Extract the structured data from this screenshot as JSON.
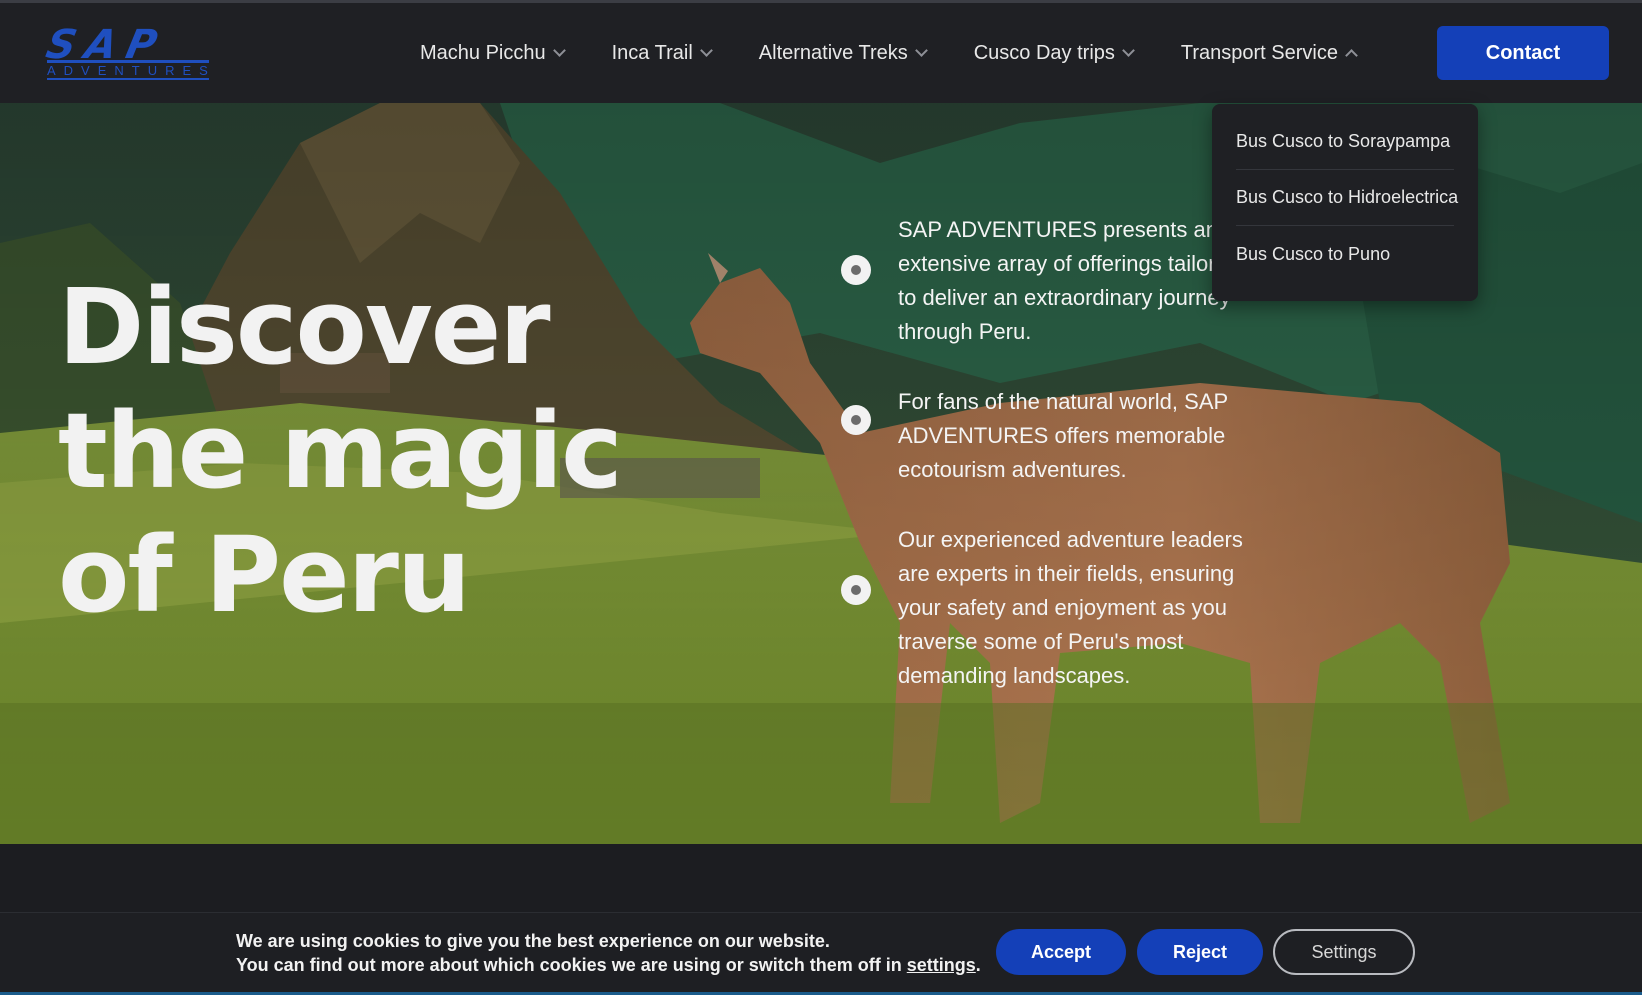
{
  "logo": {
    "main": "SAP",
    "sub": "ADVENTURES"
  },
  "nav": {
    "items": [
      {
        "label": "Machu Picchu"
      },
      {
        "label": "Inca Trail"
      },
      {
        "label": "Alternative Treks"
      },
      {
        "label": "Cusco Day trips"
      },
      {
        "label": "Transport Service"
      }
    ],
    "contact_label": "Contact"
  },
  "dropdown": {
    "items": [
      {
        "label": "Bus Cusco to Soraypampa"
      },
      {
        "label": "Bus Cusco to Hidroelectrica"
      },
      {
        "label": "Bus Cusco to Puno"
      }
    ]
  },
  "hero": {
    "headline_lines": [
      "Discover",
      "the magic",
      "of Peru"
    ],
    "bullets": [
      {
        "text": "SAP ADVENTURES presents an extensive array of offerings tailored to deliver an extraordinary journey through Peru."
      },
      {
        "text": "For fans of the natural world, SAP ADVENTURES offers memorable ecotourism adventures."
      },
      {
        "text": "Our experienced adventure leaders are experts in their fields, ensuring your safety and enjoyment as you traverse some of Peru's most demanding landscapes."
      }
    ]
  },
  "cookie": {
    "line1": "We are using cookies to give you the best experience on our website.",
    "line2_prefix": "You can find out more about which cookies we are using or switch them off in ",
    "line2_link": "settings",
    "line2_suffix": ".",
    "accept_label": "Accept",
    "reject_label": "Reject",
    "settings_label": "Settings"
  },
  "colors": {
    "accent": "#1440b8",
    "header_bg": "#1f2024",
    "page_bg": "#1c1d21"
  }
}
